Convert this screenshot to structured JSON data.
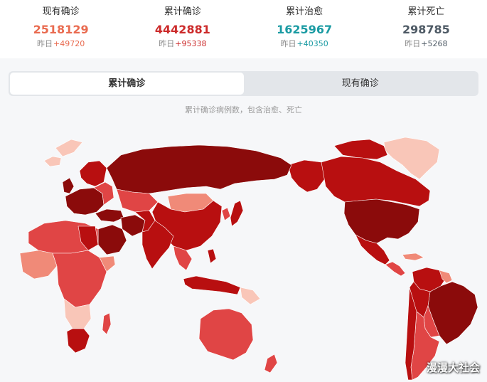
{
  "stats": [
    {
      "label": "现有确诊",
      "value": "2518129",
      "delta_prefix": "昨日",
      "delta": "+49720",
      "color": "#e96b50"
    },
    {
      "label": "累计确诊",
      "value": "4442881",
      "delta_prefix": "昨日",
      "delta": "+95338",
      "color": "#cc2b2b"
    },
    {
      "label": "累计治愈",
      "value": "1625967",
      "delta_prefix": "昨日",
      "delta": "+40350",
      "color": "#1b9ba3"
    },
    {
      "label": "累计死亡",
      "value": "298785",
      "delta_prefix": "昨日",
      "delta": "+5268",
      "color": "#4e5a65"
    }
  ],
  "tabs": [
    {
      "label": "累计确诊",
      "active": true
    },
    {
      "label": "现有确诊",
      "active": false
    }
  ],
  "subtitle": "累计确诊病例数，包含治愈、死亡",
  "watermark": "漫漫大社会",
  "colors": {
    "darkest": "#8b0b0b",
    "dark": "#b80f10",
    "mid": "#e04545",
    "light": "#f08a78",
    "lightest": "#f9c6b8"
  }
}
